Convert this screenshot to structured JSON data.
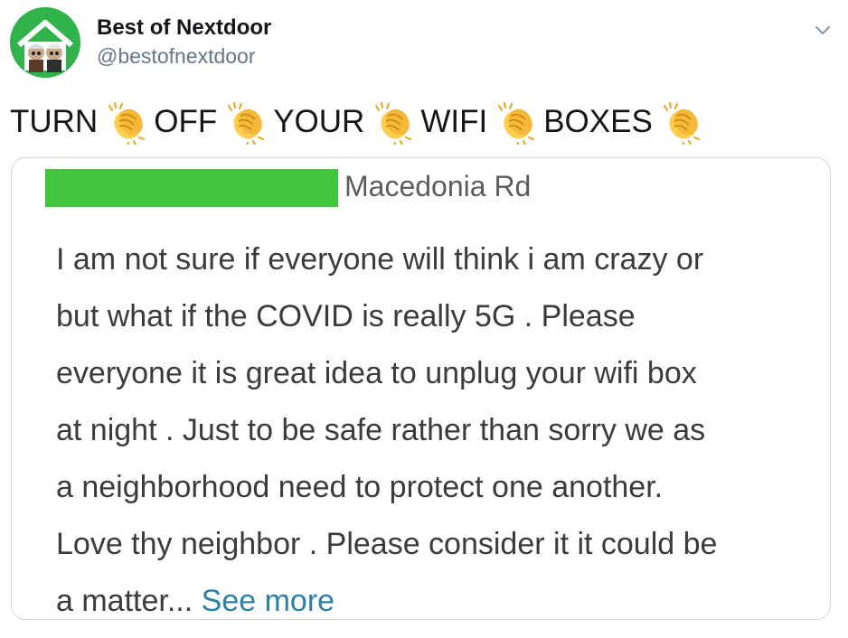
{
  "account": {
    "name": "Best of Nextdoor",
    "handle": "@bestofnextdoor",
    "avatar_icon": "nextdoor-house-avatar",
    "menu_icon": "chevron-down-icon"
  },
  "tweet": {
    "words": [
      "TURN",
      "OFF",
      "YOUR",
      "WIFI",
      "BOXES"
    ],
    "emoji_icon": "clapping-hands-icon"
  },
  "embedded_post": {
    "redaction_color": "#43c43d",
    "location": "Macedonia Rd",
    "lines": [
      "I am not sure if everyone will think i am crazy or",
      "but what if the COVID is really 5G . Please",
      "everyone it is great idea to unplug your wifi box",
      "at night . Just to be safe rather than sorry we as",
      "a neighborhood need to protect one another.",
      "Love thy neighbor . Please consider it it could be",
      "a matter..."
    ],
    "see_more_label": "See more"
  },
  "colors": {
    "brand_green": "#2fb34a",
    "link_blue": "#2b7fa8",
    "handle_gray": "#657786",
    "card_border": "#ccd6dd"
  }
}
